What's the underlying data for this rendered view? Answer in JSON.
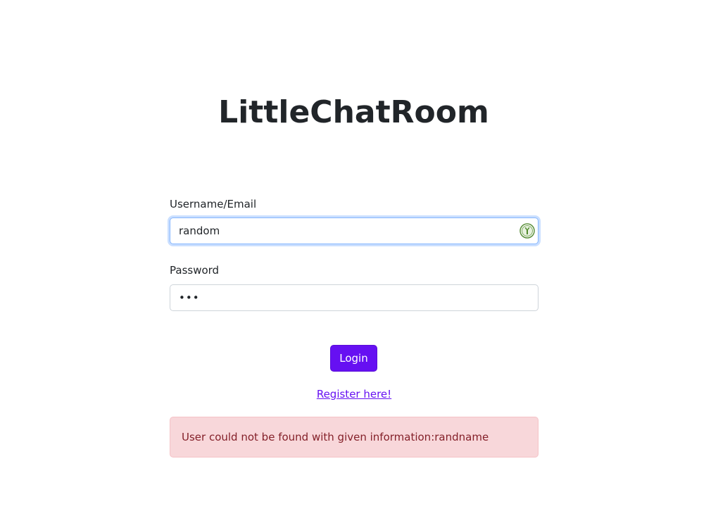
{
  "app": {
    "title": "LittleChatRoom"
  },
  "login_form": {
    "username_label": "Username/Email",
    "username_value": "random",
    "password_label": "Password",
    "password_display": "•••",
    "login_button_label": "Login",
    "register_link_label": "Register here!"
  },
  "alert": {
    "message": "User could not be found with given information:randname"
  },
  "icons": {
    "password_manager": "password-manager-icon"
  },
  "colors": {
    "primary": "#6610f2",
    "alert_background": "#f8d7da",
    "alert_text": "#842029",
    "focus_border": "#86b7fe"
  }
}
